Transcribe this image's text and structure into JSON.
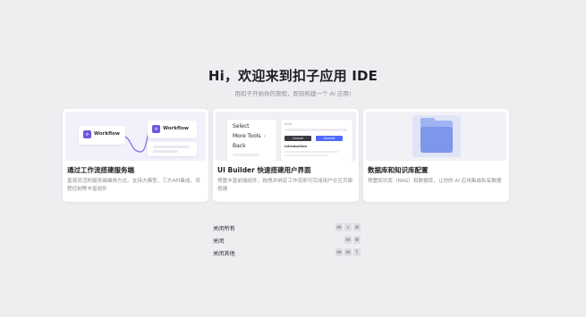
{
  "hero": {
    "title": "Hi，欢迎来到扣子应用 IDE",
    "subtitle": "用扣子开始你的旅程，即刻构建一个 AI 应用!"
  },
  "cards": [
    {
      "title": "通过工作流搭建服务端",
      "description": "直观灵活的服务端编排方式。支持大模型、三方API集成、流程控制等丰富组件",
      "thumb": {
        "node_label_1": "Workflow",
        "node_label_2": "Workflow"
      }
    },
    {
      "title": "UI Builder 快速搭建用户界面",
      "description": "预置丰富前端组件，拖拽并绑定工作流即可完成用户交互页面搭建",
      "thumb": {
        "menu_items": [
          "Select",
          "More Tools",
          "Back"
        ],
        "panel_label": "Intro",
        "btn_cancel": "Cancel",
        "btn_submit": "Submit",
        "intro_title": "Introduction"
      }
    },
    {
      "title": "数据库和知识库配置",
      "description": "预置知识库（RAG）和数据库，让你的 AI 应用集成私有数据",
      "thumb": {}
    }
  ],
  "shortcuts": [
    {
      "label": "关闭所有",
      "keys": [
        "Alt",
        "⇧",
        "W"
      ]
    },
    {
      "label": "关闭",
      "keys": [
        "Alt",
        "W"
      ]
    },
    {
      "label": "关闭其他",
      "keys": [
        "Alt",
        "Alt",
        "T"
      ]
    }
  ],
  "colors": {
    "background": "#eeedf0",
    "accent": "#6a5ae0",
    "primary_button": "#4d6bfe",
    "folder": "#7d97ea"
  },
  "icons": {
    "workflow_node": "workflow-node-icon",
    "folder": "folder-icon"
  }
}
